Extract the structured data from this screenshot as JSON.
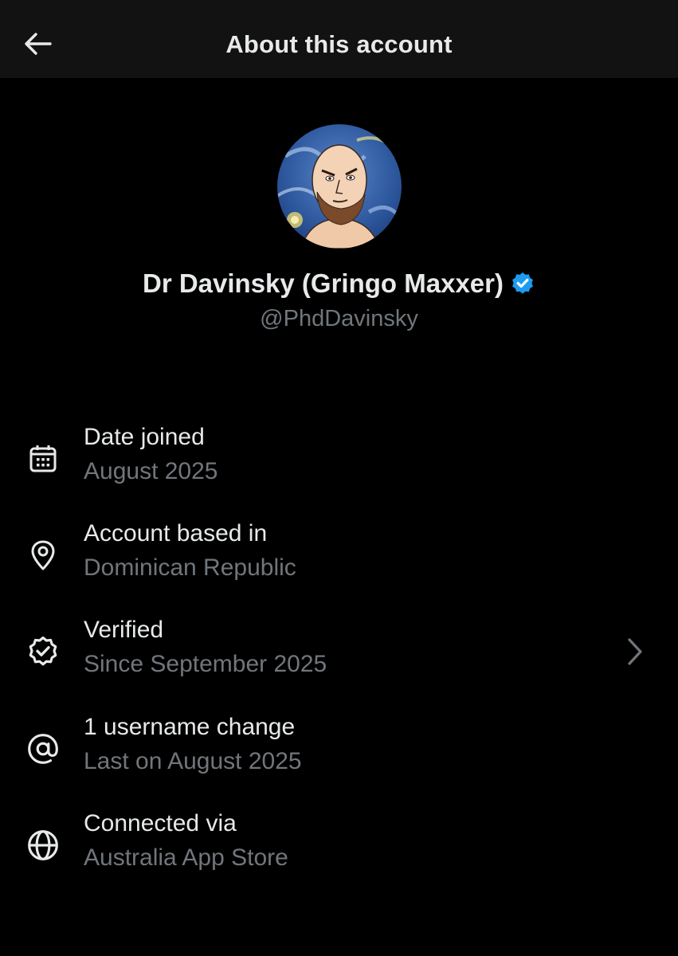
{
  "header": {
    "title": "About this account",
    "back_icon": "arrow-left-icon"
  },
  "profile": {
    "display_name": "Dr Davinsky (Gringo Maxxer)",
    "handle": "@PhdDavinsky",
    "verified_badge_color": "#1d9bf0",
    "avatar_icon": "avatar-portrait"
  },
  "details": [
    {
      "icon": "calendar-icon",
      "title": "Date joined",
      "value": "August 2025"
    },
    {
      "icon": "location-pin-icon",
      "title": "Account based in",
      "value": "Dominican Republic"
    },
    {
      "icon": "verified-check-icon",
      "title": "Verified",
      "value": "Since September 2025"
    },
    {
      "icon": "at-sign-icon",
      "title": "1 username change",
      "value": "Last on August 2025"
    },
    {
      "icon": "globe-icon",
      "title": "Connected via",
      "value": "Australia App Store"
    }
  ],
  "colors": {
    "background": "#000000",
    "header_background": "#121212",
    "primary_text": "#e7e9ea",
    "secondary_text": "#71767b",
    "accent": "#1d9bf0"
  }
}
